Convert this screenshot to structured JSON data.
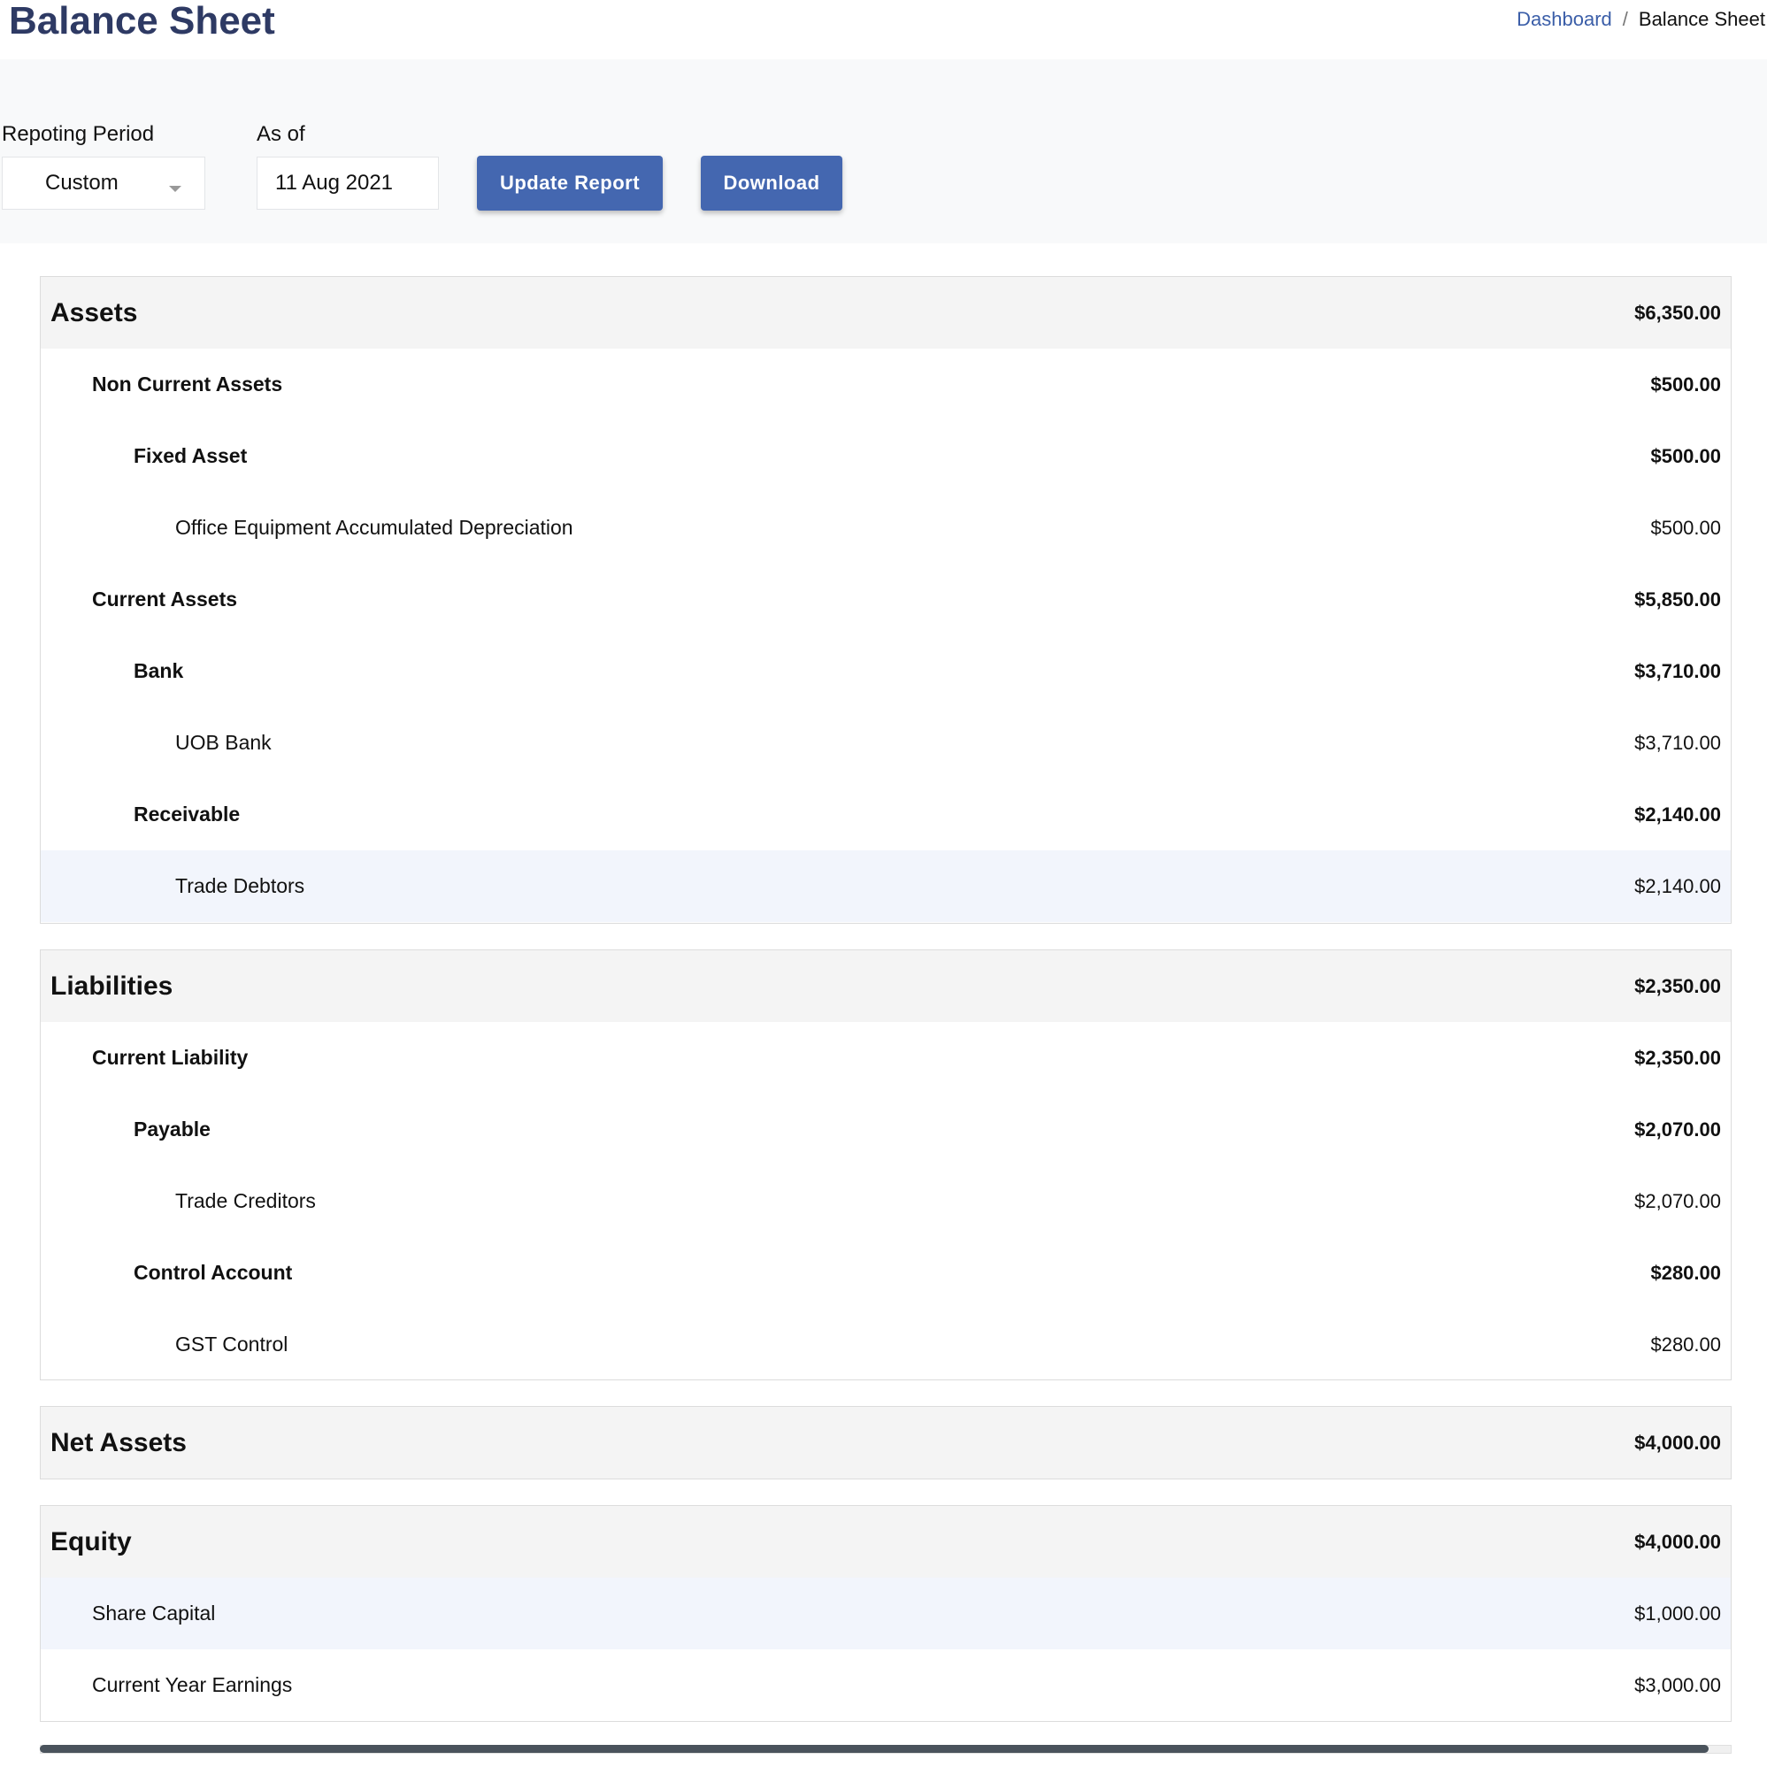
{
  "header": {
    "title": "Balance Sheet",
    "breadcrumb": {
      "link": "Dashboard",
      "separator": "/",
      "current": "Balance Sheet"
    }
  },
  "filters": {
    "period_label": "Repoting Period",
    "period_value": "Custom",
    "asof_label": "As of",
    "asof_value": "11 Aug 2021",
    "update_label": "Update Report",
    "download_label": "Download"
  },
  "assets": {
    "title": "Assets",
    "total": "$6,350.00",
    "rows": [
      {
        "label": "Non Current Assets",
        "amount": "$500.00"
      },
      {
        "label": "Fixed Asset",
        "amount": "$500.00"
      },
      {
        "label": "Office Equipment Accumulated Depreciation",
        "amount": "$500.00"
      },
      {
        "label": "Current Assets",
        "amount": "$5,850.00"
      },
      {
        "label": "Bank",
        "amount": "$3,710.00"
      },
      {
        "label": "UOB Bank",
        "amount": "$3,710.00"
      },
      {
        "label": "Receivable",
        "amount": "$2,140.00"
      },
      {
        "label": "Trade Debtors",
        "amount": "$2,140.00"
      }
    ]
  },
  "liabilities": {
    "title": "Liabilities",
    "total": "$2,350.00",
    "rows": [
      {
        "label": "Current Liability",
        "amount": "$2,350.00"
      },
      {
        "label": "Payable",
        "amount": "$2,070.00"
      },
      {
        "label": "Trade Creditors",
        "amount": "$2,070.00"
      },
      {
        "label": "Control Account",
        "amount": "$280.00"
      },
      {
        "label": "GST Control",
        "amount": "$280.00"
      }
    ]
  },
  "net_assets": {
    "title": "Net Assets",
    "total": "$4,000.00"
  },
  "equity": {
    "title": "Equity",
    "total": "$4,000.00",
    "rows": [
      {
        "label": "Share Capital",
        "amount": "$1,000.00"
      },
      {
        "label": "Current Year Earnings",
        "amount": "$3,000.00"
      }
    ]
  }
}
